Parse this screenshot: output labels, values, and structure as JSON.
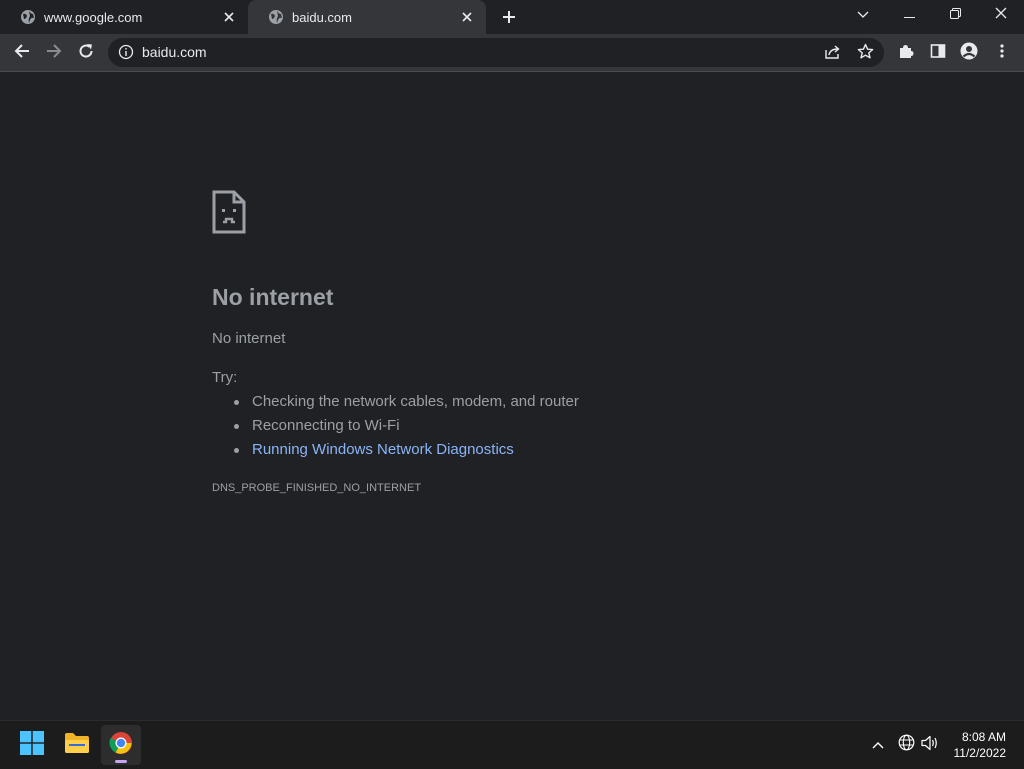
{
  "tabs": [
    {
      "title": "www.google.com",
      "active": false
    },
    {
      "title": "baidu.com",
      "active": true
    }
  ],
  "omnibox": {
    "url": "baidu.com"
  },
  "error_page": {
    "heading": "No internet",
    "subheading": "No internet",
    "try_label": "Try:",
    "suggestions": [
      {
        "text": "Checking the network cables, modem, and router",
        "link": false
      },
      {
        "text": "Reconnecting to Wi-Fi",
        "link": false
      },
      {
        "text": "Running Windows Network Diagnostics",
        "link": true
      }
    ],
    "error_code": "DNS_PROBE_FINISHED_NO_INTERNET"
  },
  "taskbar": {
    "apps": [
      "start-icon",
      "file-explorer-icon",
      "chrome-icon"
    ],
    "tray_icons": [
      "chevron-up-icon",
      "globe-icon",
      "volume-icon"
    ],
    "time": "8:08 AM",
    "date": "11/2/2022"
  },
  "colors": {
    "background": "#202124",
    "toolbar": "#35363a",
    "link": "#8ab4f8",
    "text_secondary": "#9aa0a6"
  }
}
